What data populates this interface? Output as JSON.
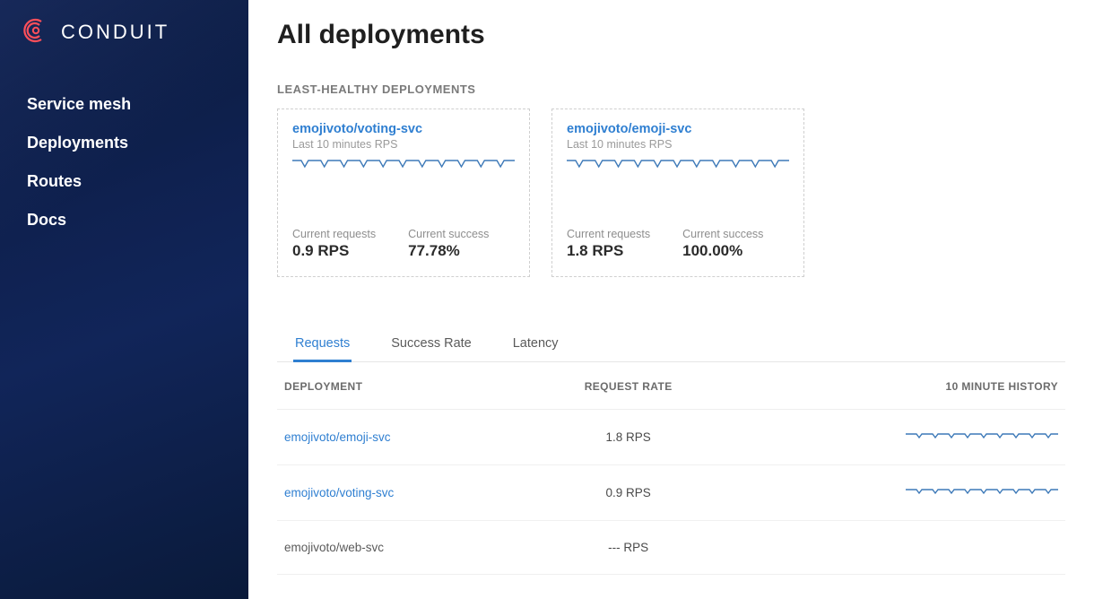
{
  "brand": {
    "name": "CONDUIT"
  },
  "nav": {
    "items": [
      {
        "label": "Service mesh"
      },
      {
        "label": "Deployments"
      },
      {
        "label": "Routes"
      },
      {
        "label": "Docs"
      }
    ]
  },
  "page": {
    "title": "All deployments",
    "section_label": "LEAST-HEALTHY DEPLOYMENTS"
  },
  "cards": [
    {
      "title": "emojivoto/voting-svc",
      "subtitle": "Last 10 minutes RPS",
      "req_label": "Current requests",
      "req_value": "0.9 RPS",
      "suc_label": "Current success",
      "suc_value": "77.78%"
    },
    {
      "title": "emojivoto/emoji-svc",
      "subtitle": "Last 10 minutes RPS",
      "req_label": "Current requests",
      "req_value": "1.8 RPS",
      "suc_label": "Current success",
      "suc_value": "100.00%"
    }
  ],
  "tabs": {
    "items": [
      {
        "label": "Requests",
        "active": true
      },
      {
        "label": "Success Rate",
        "active": false
      },
      {
        "label": "Latency",
        "active": false
      }
    ]
  },
  "table": {
    "headers": {
      "deployment": "DEPLOYMENT",
      "rate": "REQUEST RATE",
      "history": "10 MINUTE HISTORY"
    },
    "rows": [
      {
        "name": "emojivoto/emoji-svc",
        "rate": "1.8 RPS",
        "link": true,
        "has_spark": true
      },
      {
        "name": "emojivoto/voting-svc",
        "rate": "0.9 RPS",
        "link": true,
        "has_spark": true
      },
      {
        "name": "emojivoto/web-svc",
        "rate": "--- RPS",
        "link": false,
        "has_spark": false
      }
    ]
  }
}
